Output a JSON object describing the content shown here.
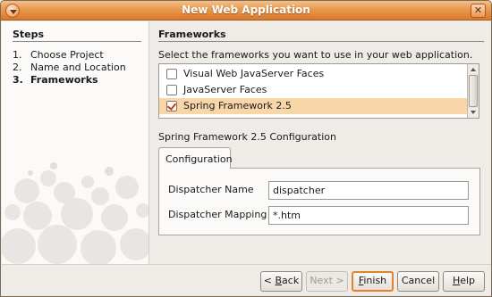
{
  "window": {
    "title": "New Web Application"
  },
  "steps": {
    "heading": "Steps",
    "items": [
      {
        "num": "1.",
        "label": "Choose Project"
      },
      {
        "num": "2.",
        "label": "Name and Location"
      },
      {
        "num": "3.",
        "label": "Frameworks"
      }
    ]
  },
  "main": {
    "heading": "Frameworks",
    "instructions": "Select the frameworks you want to use in your web application.",
    "frameworks": [
      {
        "label": "Visual Web JavaServer Faces",
        "checked": false
      },
      {
        "label": "JavaServer Faces",
        "checked": false
      },
      {
        "label": "Spring Framework 2.5",
        "checked": true
      }
    ],
    "config_title": "Spring Framework 2.5 Configuration",
    "tab_label": "Configuration",
    "fields": [
      {
        "label": "Dispatcher Name",
        "value": "dispatcher"
      },
      {
        "label": "Dispatcher Mapping",
        "value": "*.htm"
      }
    ]
  },
  "buttons": {
    "back": {
      "pre": "< ",
      "mnemonic": "B",
      "post": "ack"
    },
    "next": "Next >",
    "finish": {
      "mnemonic": "F",
      "post": "inish"
    },
    "cancel": "Cancel",
    "help": {
      "mnemonic": "H",
      "post": "elp"
    }
  },
  "colors": {
    "titlebar": "#e8994e",
    "selection": "#f8d6a7",
    "default_button_border": "#e0822f",
    "checkmark": "#c2410c"
  }
}
